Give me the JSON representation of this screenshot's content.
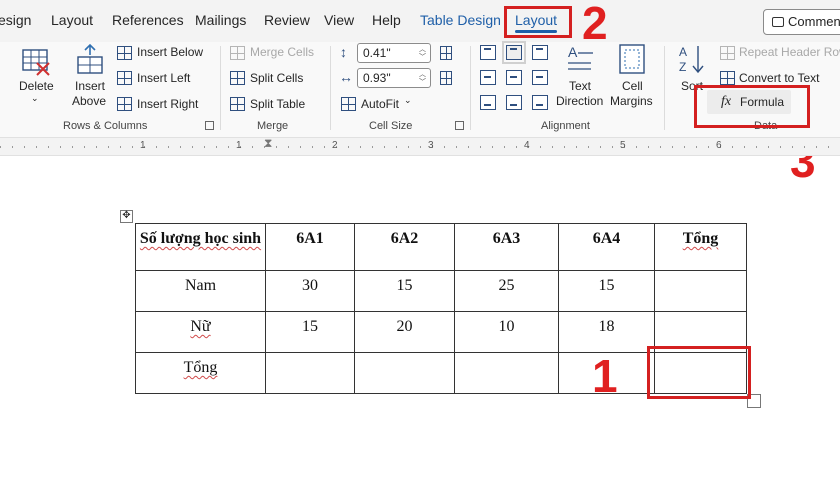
{
  "tabs": [
    {
      "label": "esign"
    },
    {
      "label": "Layout"
    },
    {
      "label": "References"
    },
    {
      "label": "Mailings"
    },
    {
      "label": "Review"
    },
    {
      "label": "View"
    },
    {
      "label": "Help"
    },
    {
      "label": "Table Design"
    },
    {
      "label": "Layout"
    }
  ],
  "comments_label": "Commen",
  "ribbon": {
    "rows_columns": {
      "delete": "Delete",
      "insert_above_1": "Insert",
      "insert_above_2": "Above",
      "insert_below": "Insert Below",
      "insert_left": "Insert Left",
      "insert_right": "Insert Right",
      "label": "Rows & Columns"
    },
    "merge": {
      "merge_cells": "Merge Cells",
      "split_cells": "Split Cells",
      "split_table": "Split Table",
      "label": "Merge"
    },
    "cell_size": {
      "height": "0.41\"",
      "width": "0.93\"",
      "autofit": "AutoFit",
      "label": "Cell Size"
    },
    "alignment": {
      "text_direction_1": "Text",
      "text_direction_2": "Direction",
      "cell_margins_1": "Cell",
      "cell_margins_2": "Margins",
      "label": "Alignment"
    },
    "data": {
      "sort": "Sort",
      "repeat_header": "Repeat Header Row",
      "convert": "Convert to Text",
      "formula": "Formula",
      "label": "Data"
    }
  },
  "ruler_numbers": [
    "1",
    "1",
    "2",
    "3",
    "4",
    "5",
    "6"
  ],
  "table": {
    "header": [
      "Số lượng học sinh",
      "6A1",
      "6A2",
      "6A3",
      "6A4",
      "Tổng"
    ],
    "rows": [
      [
        "Nam",
        "30",
        "15",
        "25",
        "15",
        ""
      ],
      [
        "Nữ",
        "15",
        "20",
        "10",
        "18",
        ""
      ],
      [
        "Tổng",
        "",
        "",
        "",
        "",
        ""
      ]
    ]
  },
  "annotations": {
    "n1": "1",
    "n2": "2",
    "n3": "3"
  },
  "colors": {
    "accent": "#1f5fa8",
    "annotation": "#e02020"
  }
}
